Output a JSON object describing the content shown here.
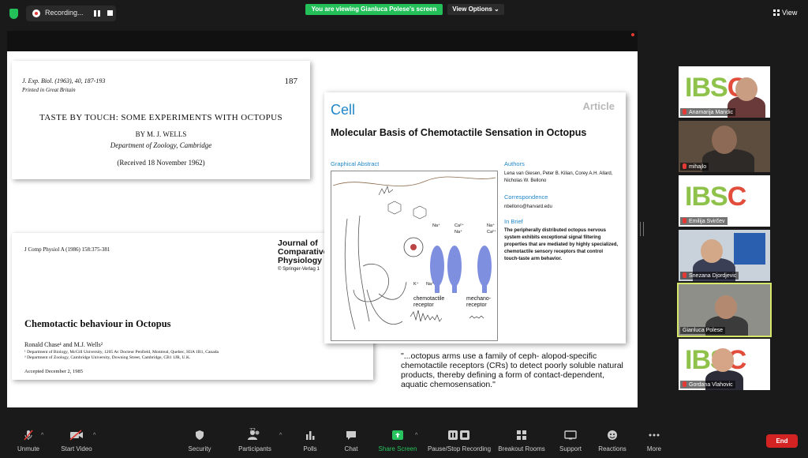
{
  "top": {
    "recording_label": "Recording...",
    "viewing_banner": "You are viewing Gianluca Polese's screen",
    "view_options": "View Options ⌄",
    "view_label": "View"
  },
  "slide": {
    "paper1": {
      "citation": "J. Exp. Biol. (1963), 40, 187-193",
      "printed": "Printed in Great Britain",
      "page": "187",
      "title": "TASTE BY TOUCH: SOME EXPERIMENTS WITH OCTOPUS",
      "author": "BY M. J. WELLS",
      "department": "Department of Zoology, Cambridge",
      "received": "(Received 18 November 1962)"
    },
    "paper2": {
      "citation": "J Comp Physiol A (1986) 158:375-381",
      "journal": "Journal of Comparative Physiology",
      "springer": "© Springer-Verlag 1",
      "title": "Chemotactic behaviour in Octopus",
      "authors": "Ronald Chase¹ and M.J. Wells²",
      "aff1": "¹ Department of Biology, McGill University, 1205 Av Docteur Penfield, Montreal, Quebec, H3A 1B1, Canada",
      "aff2": "² Department of Zoology, Cambridge University, Downing Street, Cambridge, CB1 1JR, U.K.",
      "accepted": "Accepted December 2, 1985"
    },
    "cell": {
      "logo": "Cell",
      "article": "Article",
      "title": "Molecular Basis of Chemotactile Sensation in Octopus",
      "graphical_abstract": "Graphical Abstract",
      "authors_h": "Authors",
      "authors": "Lena van Giesen, Peter B. Kilian, Corey A.H. Allard, Nicholas W. Bellono",
      "correspondence_h": "Correspondence",
      "correspondence": "nbellono@harvard.edu",
      "inbrief_h": "In Brief",
      "inbrief": "The peripherally distributed octopus nervous system exhibits exceptional signal filtering properties that are mediated by highly specialized, chemotactile sensory receptors that control touch-taste arm behavior.",
      "fig_label1": "chemotactile receptor",
      "fig_label2": "mechano-receptor",
      "ion_na": "Na⁺",
      "ion_ca": "Ca²⁺",
      "ion_k": "K⁺"
    },
    "quote": "\"...octopus arms use a family of ceph- alopod-specific chemotactile receptors (CRs) to detect poorly soluble natural products, thereby defining a form of contact-dependent, aquatic chemosensation.\""
  },
  "participants": [
    {
      "name": "Anamarija Mandic"
    },
    {
      "name": "mihajlo"
    },
    {
      "name": "Emilija Svirčev"
    },
    {
      "name": "Snezana Djordjevic"
    },
    {
      "name": "Gianluca Polese"
    },
    {
      "name": "Gordana Vlahovic"
    }
  ],
  "toolbar": {
    "unmute": "Unmute",
    "start_video": "Start Video",
    "security": "Security",
    "participants": "Participants",
    "participant_count": "72",
    "polls": "Polls",
    "chat": "Chat",
    "share_screen": "Share Screen",
    "pause_recording": "Pause/Stop Recording",
    "breakout": "Breakout Rooms",
    "support": "Support",
    "reactions": "Reactions",
    "more": "More",
    "end": "End"
  }
}
